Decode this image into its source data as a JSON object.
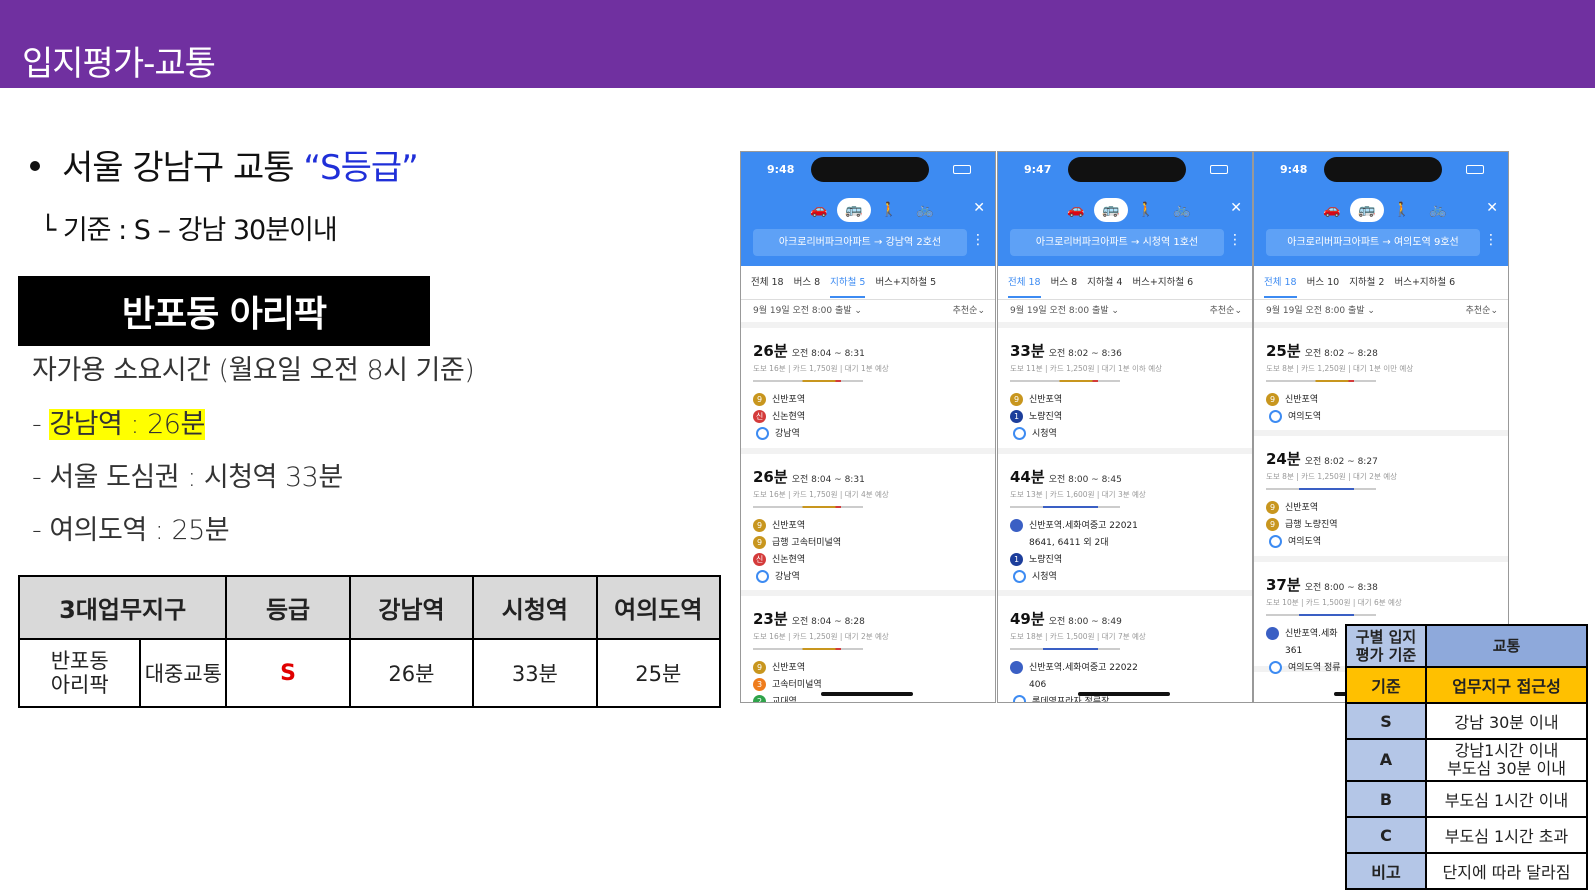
{
  "header": {
    "title": "입지평가-교통"
  },
  "bullet": {
    "prefix": "서울 강남구 교통 ",
    "grade": "“S등급”"
  },
  "criteria_line": "└ 기준 : S – 강남 30분이내",
  "apartment": {
    "name": "반포동 아리팍"
  },
  "commute": {
    "heading": "자가용 소요시간 (월요일 오전 8시 기준)",
    "dash1": "- ",
    "line1": "강남역 : 26분",
    "line2": "- 서울 도심권 : 시청역 33분",
    "line3": "- 여의도역 : 25분"
  },
  "grade_table": {
    "headers": [
      "3대업무지구",
      "등급",
      "강남역",
      "시청역",
      "여의도역"
    ],
    "row": {
      "apt": "반포동\n아리팍",
      "type": "대중교통",
      "grade": "S",
      "gangnam": "26분",
      "cityhall": "33분",
      "yeouido": "25분"
    }
  },
  "phones": [
    {
      "time": "9:48",
      "route": "아크로리버파크아파트 → 강남역 2호선",
      "tabs": [
        "전체 18",
        "버스 8",
        "지하철 5",
        "버스+지하철 5"
      ],
      "active_tab": 2,
      "depart": "9월 19일 오전 8:00 출발 ⌄",
      "sort": "추천순⌄",
      "results": [
        {
          "dur": "26분",
          "span": "오전 8:04 ~ 8:31",
          "meta": "도보 16분 | 카드 1,750원 | 대기 1분 예상",
          "stops": [
            [
              "9",
              "b9",
              "신반포역"
            ],
            [
              "신분",
              "bnb",
              "신논현역"
            ],
            [
              "",
              "bdot",
              "강남역"
            ]
          ]
        },
        {
          "dur": "26분",
          "span": "오전 8:04 ~ 8:31",
          "meta": "도보 16분 | 카드 1,750원 | 대기 4분 예상",
          "stops": [
            [
              "9",
              "b9",
              "신반포역"
            ],
            [
              "9",
              "b9",
              "급행 고속터미널역"
            ],
            [
              "신분",
              "bnb",
              "신논현역"
            ],
            [
              "",
              "bdot",
              "강남역"
            ]
          ]
        },
        {
          "dur": "23분",
          "span": "오전 8:04 ~ 8:28",
          "meta": "도보 16분 | 카드 1,250원 | 대기 2분 예상",
          "stops": [
            [
              "9",
              "b9",
              "신반포역"
            ],
            [
              "3",
              "b3",
              "고속터미널역"
            ],
            [
              "2",
              "b2",
              "교대역"
            ]
          ]
        }
      ]
    },
    {
      "time": "9:47",
      "route": "아크로리버파크아파트 → 시청역 1호선",
      "tabs": [
        "전체 18",
        "버스 8",
        "지하철 4",
        "버스+지하철 6"
      ],
      "active_tab": 0,
      "depart": "9월 19일 오전 8:00 출발 ⌄",
      "sort": "추천순⌄",
      "results": [
        {
          "dur": "33분",
          "span": "오전 8:02 ~ 8:36",
          "meta": "도보 11분 | 카드 1,250원 | 대기 1분 이하 예상",
          "stops": [
            [
              "9",
              "b9",
              "신반포역"
            ],
            [
              "1",
              "b1",
              "노량진역"
            ],
            [
              "",
              "bdot",
              "시청역"
            ]
          ]
        },
        {
          "dur": "44분",
          "span": "오전 8:00 ~ 8:45",
          "meta": "도보 13분 | 카드 1,600원 | 대기 3분 예상",
          "stops": [
            [
              "",
              "bbus",
              "신반포역.세화여중고 22021"
            ],
            [
              "",
              "",
              "8641, 6411 외 2대"
            ],
            [
              "1",
              "b1",
              "노량진역"
            ],
            [
              "",
              "bdot",
              "시청역"
            ]
          ]
        },
        {
          "dur": "49분",
          "span": "오전 8:00 ~ 8:49",
          "meta": "도보 18분 | 카드 1,500원 | 대기 7분 예상",
          "stops": [
            [
              "",
              "bbus",
              "신반포역.세화여중고 22022"
            ],
            [
              "",
              "",
              "406"
            ],
            [
              "",
              "bdot",
              "롯데영프라자 정류장"
            ]
          ]
        }
      ]
    },
    {
      "time": "9:48",
      "route": "아크로리버파크아파트 → 여의도역 9호선",
      "tabs": [
        "전체 18",
        "버스 10",
        "지하철 2",
        "버스+지하철 6"
      ],
      "active_tab": 0,
      "depart": "9월 19일 오전 8:00 출발 ⌄",
      "sort": "추천순⌄",
      "results": [
        {
          "dur": "25분",
          "span": "오전 8:02 ~ 8:28",
          "meta": "도보 8분 | 카드 1,250원 | 대기 1분 이만 예상",
          "stops": [
            [
              "9",
              "b9",
              "신반포역"
            ],
            [
              "",
              "bdot",
              "여의도역"
            ]
          ]
        },
        {
          "dur": "24분",
          "span": "오전 8:02 ~ 8:27",
          "meta": "도보 8분 | 카드 1,250원 | 대기 2분 예상",
          "stops": [
            [
              "9",
              "b9",
              "신반포역"
            ],
            [
              "9",
              "b9",
              "급행 노량진역"
            ],
            [
              "",
              "bdot",
              "여의도역"
            ]
          ]
        },
        {
          "dur": "37분",
          "span": "오전 8:00 ~ 8:38",
          "meta": "도보 10분 | 카드 1,500원 | 대기 6분 예상",
          "stops": [
            [
              "",
              "bbus",
              "신반포역.세화"
            ],
            [
              "",
              "",
              "361"
            ],
            [
              "",
              "bdot",
              "여의도역 정류"
            ]
          ]
        }
      ]
    }
  ],
  "criteria_table": {
    "h1_left": "구별 입지\n평가 기준",
    "h1_right": "교통",
    "h2_left": "기준",
    "h2_right": "업무지구 접근성",
    "rows": [
      {
        "level": "S",
        "desc": "강남 30분 이내"
      },
      {
        "level": "A",
        "desc": "강남1시간 이내\n부도심 30분 이내"
      },
      {
        "level": "B",
        "desc": "부도심 1시간 이내"
      },
      {
        "level": "C",
        "desc": "부도심 1시간 초과"
      },
      {
        "level": "비고",
        "desc": "단지에 따라 달라짐"
      }
    ]
  }
}
